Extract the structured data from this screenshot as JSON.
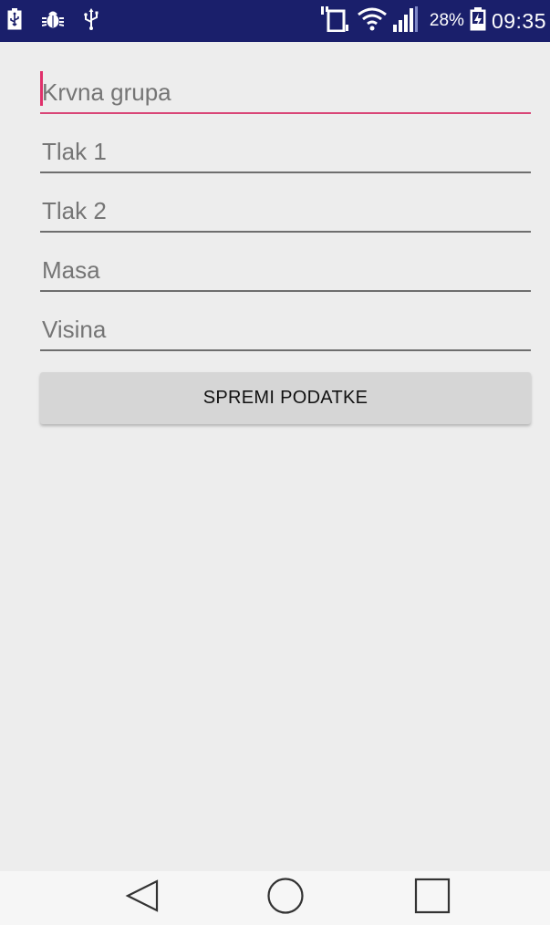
{
  "status_bar": {
    "battery_percent": "28%",
    "time": "09:35",
    "bg_color": "#1a1f6b",
    "icons_left": [
      "usb-battery-icon",
      "bug-icon",
      "usb-icon"
    ],
    "icons_right": [
      "vibrate-icon",
      "wifi-icon",
      "signal-icon",
      "charging-battery-icon"
    ]
  },
  "form": {
    "fields": [
      {
        "placeholder": "Krvna grupa",
        "value": "",
        "focused": true
      },
      {
        "placeholder": "Tlak 1",
        "value": ""
      },
      {
        "placeholder": "Tlak 2",
        "value": ""
      },
      {
        "placeholder": "Masa",
        "value": ""
      },
      {
        "placeholder": "Visina",
        "value": ""
      }
    ],
    "submit_label": "SPREMI PODATKE",
    "accent_color": "#d94677"
  },
  "nav_bar": {
    "buttons": [
      "back-icon",
      "home-icon",
      "recents-icon"
    ]
  }
}
